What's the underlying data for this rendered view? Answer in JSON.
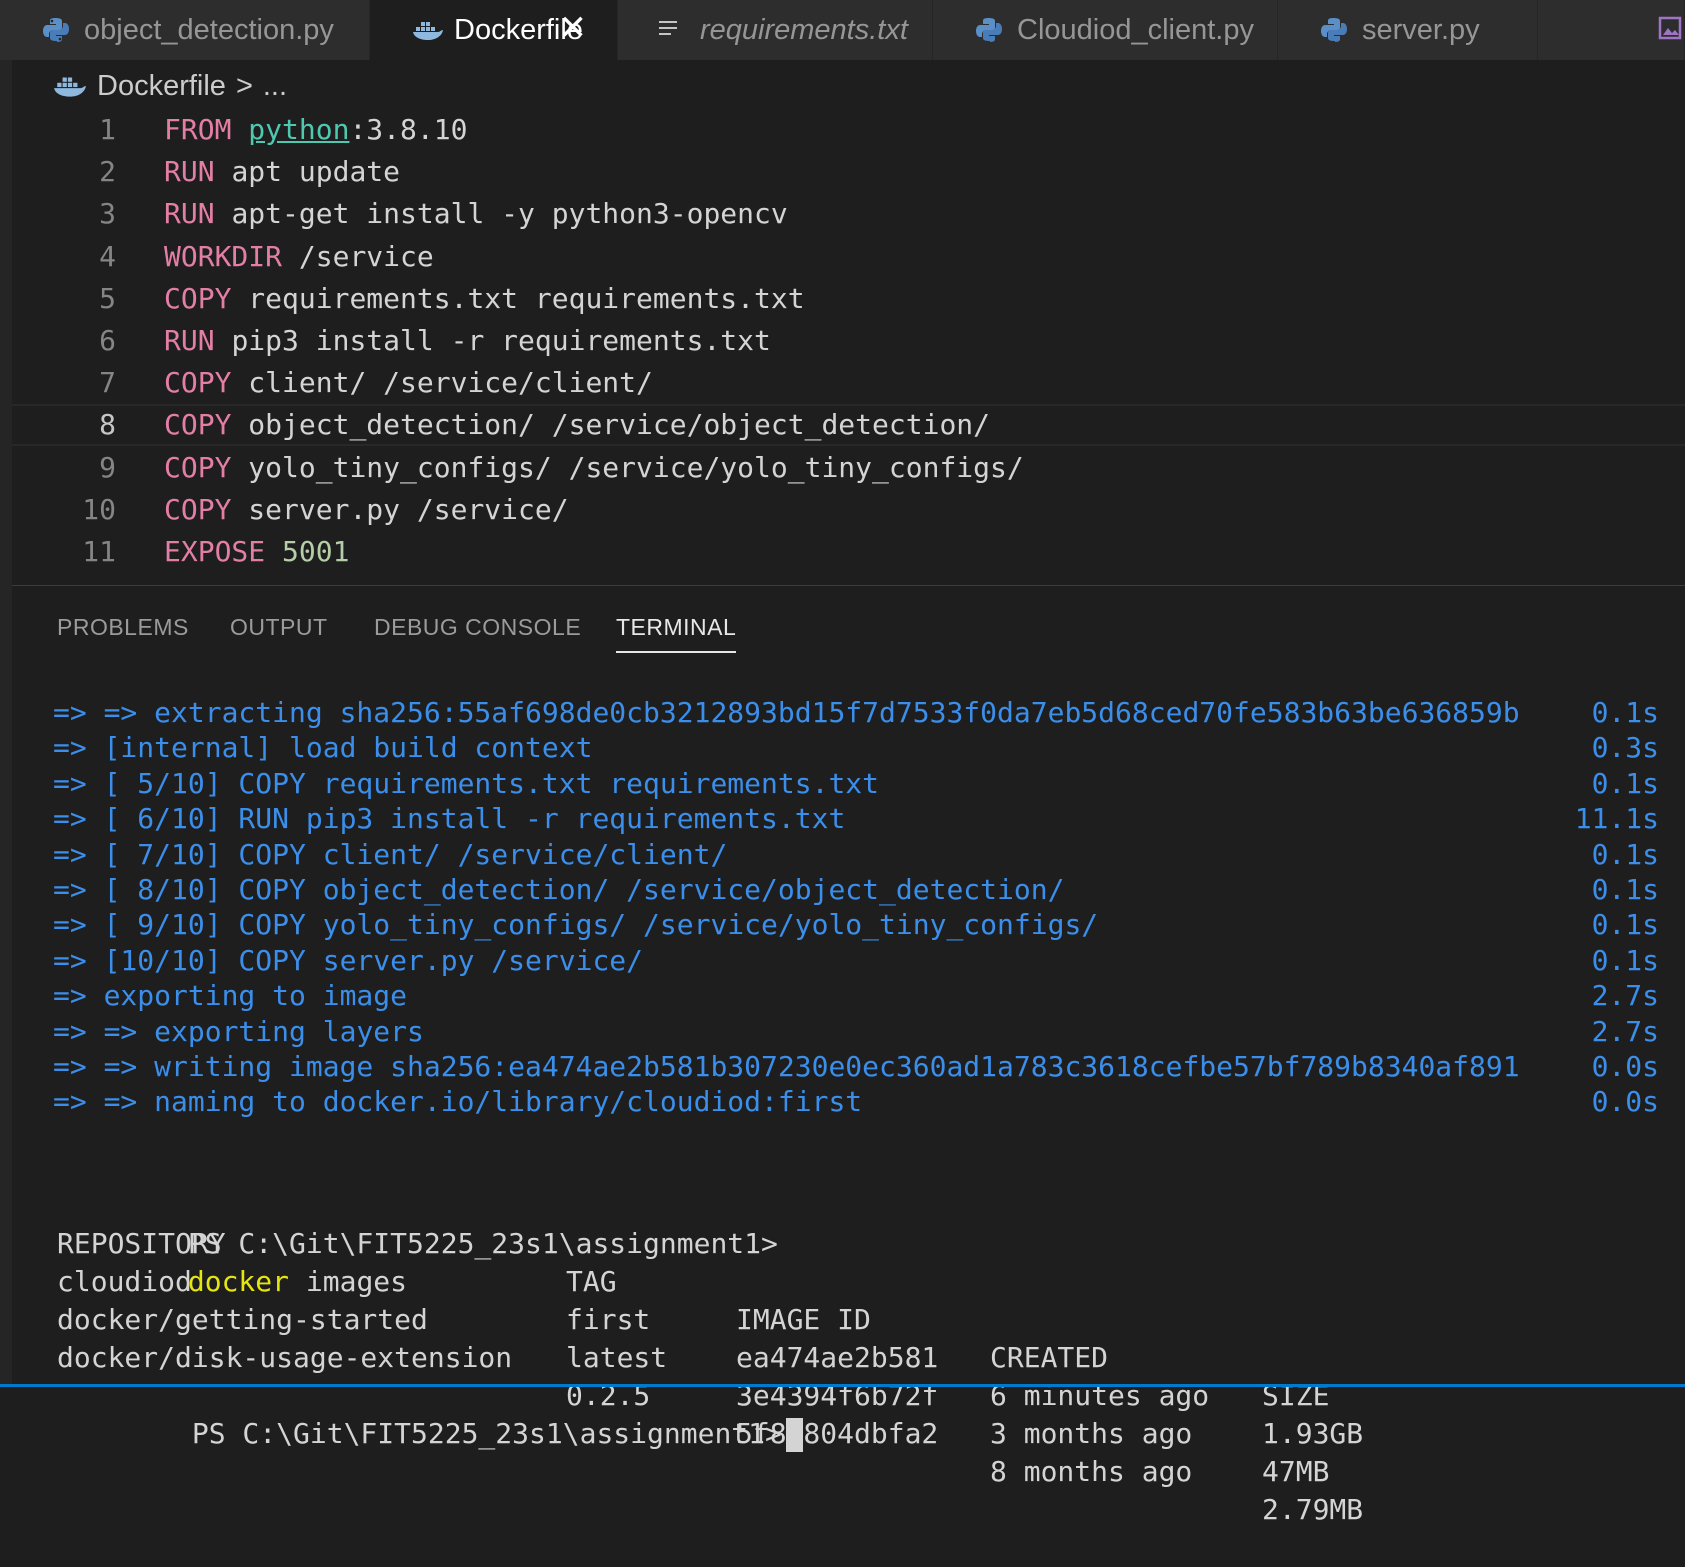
{
  "tabs": [
    {
      "label": "object_detection.py",
      "icon": "python-icon",
      "active": false
    },
    {
      "label": "Dockerfile",
      "icon": "docker-icon",
      "active": true,
      "close": "✕"
    },
    {
      "label": "requirements.txt",
      "icon": "text-lines-icon",
      "active": false
    },
    {
      "label": "Cloudiod_client.py",
      "icon": "python-icon",
      "active": false
    },
    {
      "label": "server.py",
      "icon": "python-icon",
      "active": false
    }
  ],
  "breadcrumb": {
    "file": "Dockerfile",
    "separator": ">",
    "more": "..."
  },
  "editor": {
    "current_line": 8,
    "lines": [
      {
        "n": "1",
        "kw": "FROM",
        "rest": [
          {
            "t": "python",
            "c": "img"
          },
          {
            "t": ":3.8.10",
            "c": "txt"
          }
        ]
      },
      {
        "n": "2",
        "kw": "RUN",
        "rest": [
          {
            "t": "apt update",
            "c": "txt"
          }
        ]
      },
      {
        "n": "3",
        "kw": "RUN",
        "rest": [
          {
            "t": "apt-get install -y python3-opencv",
            "c": "txt"
          }
        ]
      },
      {
        "n": "4",
        "kw": "WORKDIR",
        "rest": [
          {
            "t": "/service",
            "c": "txt"
          }
        ]
      },
      {
        "n": "5",
        "kw": "COPY",
        "rest": [
          {
            "t": "requirements.txt requirements.txt",
            "c": "txt"
          }
        ]
      },
      {
        "n": "6",
        "kw": "RUN",
        "rest": [
          {
            "t": "pip3 install -r requirements.txt",
            "c": "txt"
          }
        ]
      },
      {
        "n": "7",
        "kw": "COPY",
        "rest": [
          {
            "t": "client/ /service/client/",
            "c": "txt"
          }
        ]
      },
      {
        "n": "8",
        "kw": "COPY",
        "rest": [
          {
            "t": "object_detection/ /service/object_detection/",
            "c": "txt"
          }
        ]
      },
      {
        "n": "9",
        "kw": "COPY",
        "rest": [
          {
            "t": "yolo_tiny_configs/ /service/yolo_tiny_configs/",
            "c": "txt"
          }
        ]
      },
      {
        "n": "10",
        "kw": "COPY",
        "rest": [
          {
            "t": "server.py /service/",
            "c": "txt"
          }
        ]
      },
      {
        "n": "11",
        "kw": "EXPOSE",
        "rest": [
          {
            "t": "5001",
            "c": "num"
          }
        ]
      }
    ]
  },
  "panel": {
    "tabs": [
      {
        "label": "PROBLEMS",
        "active": false
      },
      {
        "label": "OUTPUT",
        "active": false
      },
      {
        "label": "DEBUG CONSOLE",
        "active": false
      },
      {
        "label": "TERMINAL",
        "active": true
      }
    ]
  },
  "terminal": {
    "build_lines": [
      {
        "text": "=> => extracting sha256:55af698de0cb3212893bd15f7d7533f0da7eb5d68ced70fe583b63be636859b",
        "time": "0.1s"
      },
      {
        "text": "=> [internal] load build context",
        "time": "0.3s"
      },
      {
        "text": "=> [ 5/10] COPY requirements.txt requirements.txt",
        "time": "0.1s"
      },
      {
        "text": "=> [ 6/10] RUN pip3 install -r requirements.txt",
        "time": "11.1s"
      },
      {
        "text": "=> [ 7/10] COPY client/ /service/client/",
        "time": "0.1s"
      },
      {
        "text": "=> [ 8/10] COPY object_detection/ /service/object_detection/",
        "time": "0.1s"
      },
      {
        "text": "=> [ 9/10] COPY yolo_tiny_configs/ /service/yolo_tiny_configs/",
        "time": "0.1s"
      },
      {
        "text": "=> [10/10] COPY server.py /service/",
        "time": "0.1s"
      },
      {
        "text": "=> exporting to image",
        "time": "2.7s"
      },
      {
        "text": "=> => exporting layers",
        "time": "2.7s"
      },
      {
        "text": "=> => writing image sha256:ea474ae2b581b307230e0ec360ad1a783c3618cefbe57bf789b8340af891",
        "time": "0.0s"
      },
      {
        "text": "=> => naming to docker.io/library/cloudiod:first",
        "time": "0.0s"
      }
    ],
    "prompt": "PS C:\\Git\\FIT5225_23s1\\assignment1>",
    "command": "docker",
    "command_args": " images",
    "headers": [
      "REPOSITORY",
      "TAG",
      "IMAGE ID",
      "CREATED",
      "SIZE"
    ],
    "rows": [
      [
        "cloudiod",
        "first",
        "ea474ae2b581",
        "6 minutes ago",
        "1.93GB"
      ],
      [
        "docker/getting-started",
        "latest",
        "3e4394f6b72f",
        "3 months ago",
        "47MB"
      ],
      [
        "docker/disk-usage-extension",
        "0.2.5",
        "5f8f804dbfa2",
        "8 months ago",
        "2.79MB"
      ]
    ],
    "final_prompt": "PS C:\\Git\\FIT5225_23s1\\assignment1>"
  },
  "colors": {
    "keyword": "#e37fa5",
    "image": "#4ec9b0",
    "number": "#b5cea8",
    "build_output": "#3b8eea",
    "command": "#e5e510",
    "accent": "#007acc"
  }
}
